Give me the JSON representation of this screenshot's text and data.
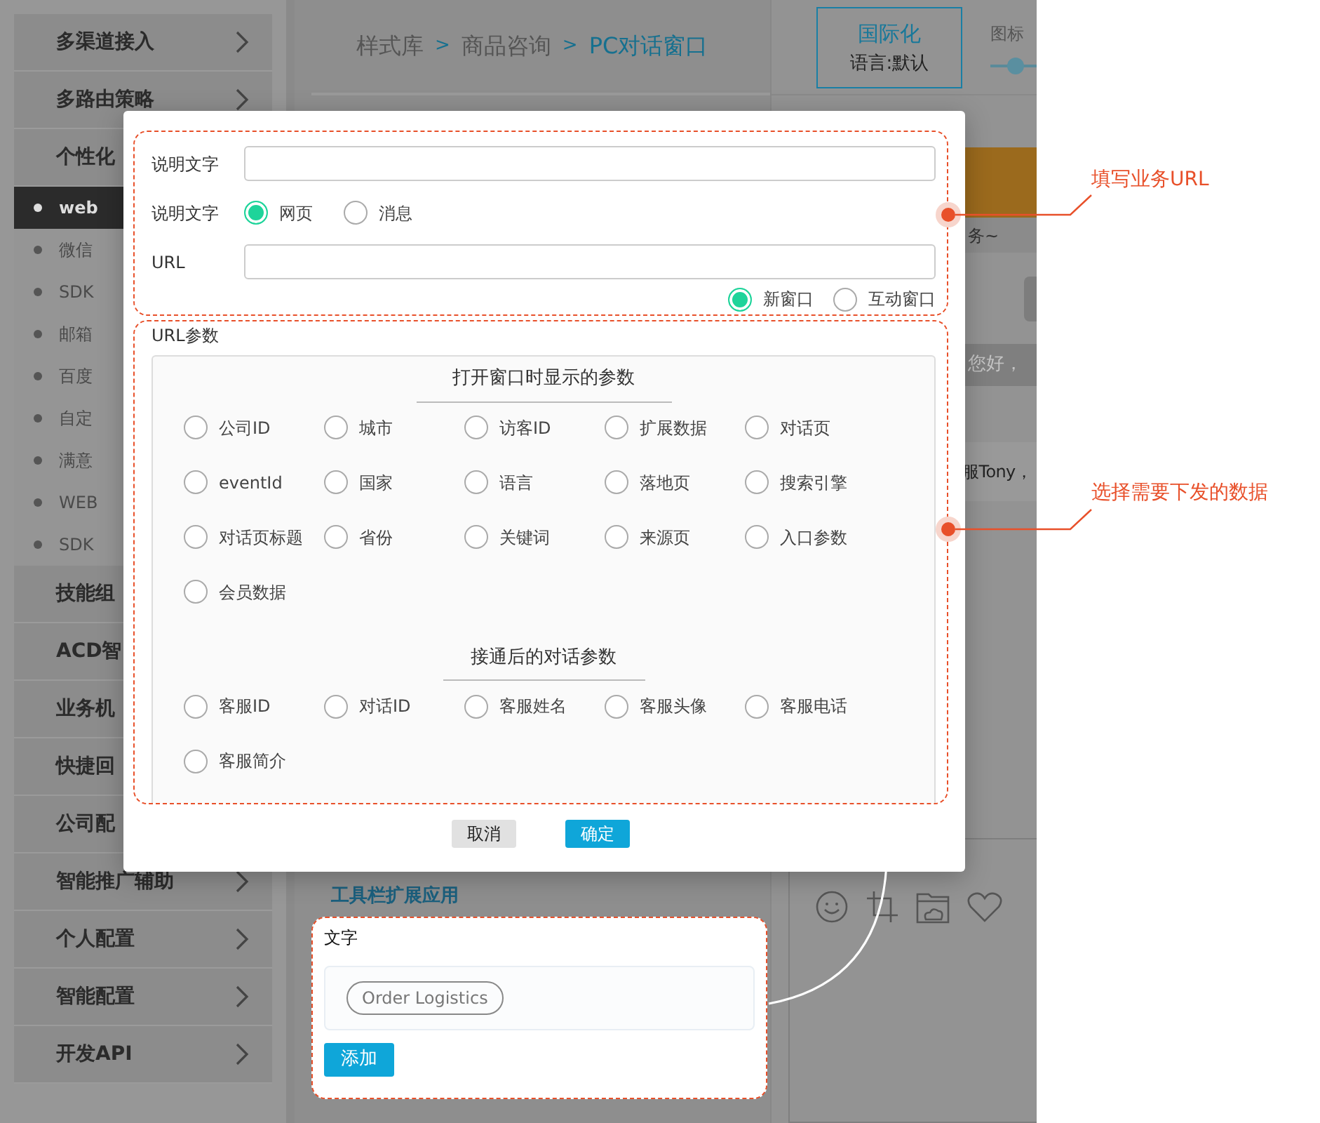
{
  "sidebar": {
    "items": [
      {
        "label": "多渠道接入",
        "kind": "group",
        "selected": false,
        "chevron": true
      },
      {
        "label": "多路由策略",
        "kind": "group",
        "selected": false,
        "chevron": true
      },
      {
        "label": "个性化",
        "kind": "group",
        "selected": false
      },
      {
        "label": "web",
        "kind": "sub",
        "selected": true
      },
      {
        "label": "微信",
        "kind": "sub",
        "selected": false
      },
      {
        "label": "SDK",
        "kind": "sub",
        "selected": false
      },
      {
        "label": "邮箱",
        "kind": "sub",
        "selected": false
      },
      {
        "label": "百度",
        "kind": "sub",
        "selected": false
      },
      {
        "label": "自定",
        "kind": "sub",
        "selected": false
      },
      {
        "label": "满意",
        "kind": "sub",
        "selected": false
      },
      {
        "label": "WEB",
        "kind": "sub",
        "selected": false
      },
      {
        "label": "SDK",
        "kind": "sub",
        "selected": false
      },
      {
        "label": "技能组",
        "kind": "group",
        "selected": false
      },
      {
        "label": "ACD智",
        "kind": "group",
        "selected": false
      },
      {
        "label": "业务机",
        "kind": "group",
        "selected": false
      },
      {
        "label": "快捷回",
        "kind": "group",
        "selected": false
      },
      {
        "label": "公司配",
        "kind": "group",
        "selected": false
      },
      {
        "label": "智能推广辅助",
        "kind": "group",
        "selected": false,
        "chevron": true
      },
      {
        "label": "个人配置",
        "kind": "group",
        "selected": false,
        "chevron": true
      },
      {
        "label": "智能配置",
        "kind": "group",
        "selected": false,
        "chevron": true
      },
      {
        "label": "开发API",
        "kind": "group",
        "selected": false,
        "chevron": true
      }
    ]
  },
  "breadcrumb": [
    {
      "text": "样式库",
      "kind": "crumb",
      "selected": false
    },
    {
      "text": ">",
      "kind": "sep"
    },
    {
      "text": "商品咨询",
      "kind": "crumb",
      "selected": false
    },
    {
      "text": ">",
      "kind": "sep"
    },
    {
      "text": "PC对话窗口",
      "kind": "crumb",
      "selected": true
    }
  ],
  "right_panel": {
    "language_title": "国际化",
    "language_value": "语言:默认",
    "icon_label": "图标",
    "icon_slider": {
      "level": 0.55
    },
    "banner_text": "务~",
    "hint": "您好，",
    "message": "服Tony，"
  },
  "toolbar_section": {
    "title": "工具栏扩展应用"
  },
  "callout": {
    "label": "文字",
    "chips": [
      "Order Logistics"
    ],
    "add_button": "添加"
  },
  "modal": {
    "rows": [
      {
        "kind": "input",
        "label": "说明文字"
      },
      {
        "kind": "radio",
        "label": "说明文字",
        "options": [
          {
            "label": "网页",
            "selected": true
          },
          {
            "label": "消息",
            "selected": false
          }
        ]
      },
      {
        "kind": "input",
        "label": "URL"
      }
    ],
    "window_options": [
      {
        "label": "新窗口",
        "selected": true
      },
      {
        "label": "互动窗口",
        "selected": false
      }
    ],
    "params_label": "URL参数",
    "groups": [
      {
        "title": "打开窗口时显示的参数",
        "options": [
          {
            "label": "公司ID",
            "selected": false
          },
          {
            "label": "城市",
            "selected": false
          },
          {
            "label": "访客ID",
            "selected": false
          },
          {
            "label": "扩展数据",
            "selected": false
          },
          {
            "label": "对话页",
            "selected": false
          },
          {
            "label": "eventId",
            "selected": false
          },
          {
            "label": "国家",
            "selected": false
          },
          {
            "label": "语言",
            "selected": false
          },
          {
            "label": "落地页",
            "selected": false
          },
          {
            "label": "搜索引擎",
            "selected": false
          },
          {
            "label": "对话页标题",
            "selected": false
          },
          {
            "label": "省份",
            "selected": false
          },
          {
            "label": "关键词",
            "selected": false
          },
          {
            "label": "来源页",
            "selected": false
          },
          {
            "label": "入口参数",
            "selected": false
          },
          {
            "label": "会员数据",
            "selected": false
          }
        ]
      },
      {
        "title": "接通后的对话参数",
        "options": [
          {
            "label": "客服ID",
            "selected": false
          },
          {
            "label": "对话ID",
            "selected": false
          },
          {
            "label": "客服姓名",
            "selected": false
          },
          {
            "label": "客服头像",
            "selected": false
          },
          {
            "label": "客服电话",
            "selected": false
          },
          {
            "label": "客服简介",
            "selected": false
          }
        ]
      }
    ],
    "buttons": [
      {
        "label": "取消",
        "kind": "secondary"
      },
      {
        "label": "确定",
        "kind": "primary"
      }
    ]
  },
  "annotations": [
    {
      "text": "填写业务URL"
    },
    {
      "text": "选择需要下发的数据"
    }
  ]
}
